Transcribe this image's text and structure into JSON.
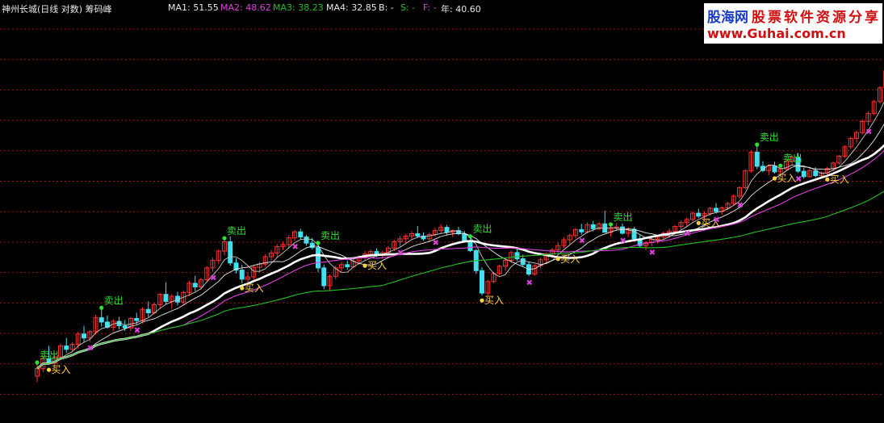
{
  "header": {
    "title": "神州长城(日线 对数) 筹码峰",
    "ma1": "MA1: 51.55",
    "ma2": "MA2: 48.62",
    "ma3": "MA3: 38.23",
    "ma4": "MA4: 32.85",
    "b": "B: -",
    "s": "S: -",
    "f": "F: -",
    "year": "年: 40.60"
  },
  "watermark": {
    "site": "股海网",
    "subtitle": "股票软件资源分享",
    "url": "www.Guhai.com.cn"
  },
  "colors": {
    "background": "#000000",
    "up_candle": "#ff3030",
    "down_candle": "#40e0f0",
    "ma1": "#ffffff",
    "ma2": "#e040e0",
    "ma3": "#20c020",
    "ma4": "#ffffff",
    "sell_signal": "#30e030",
    "buy_signal": "#ffd040",
    "gridline": "#a01818"
  },
  "chart_data": {
    "type": "candlestick",
    "title": "神州长城(日线 对数) 筹码峰",
    "scale": "log",
    "grid": true,
    "ohlc": [
      [
        20.2,
        21.5,
        19.6,
        21.0
      ],
      [
        21.0,
        22.4,
        20.6,
        22.1
      ],
      [
        22.1,
        23.6,
        21.4,
        21.6
      ],
      [
        21.6,
        22.5,
        20.9,
        22.3
      ],
      [
        22.3,
        23.9,
        22.0,
        23.6
      ],
      [
        23.6,
        24.6,
        22.8,
        23.2
      ],
      [
        23.2,
        24.1,
        22.9,
        23.8
      ],
      [
        23.8,
        25.4,
        23.3,
        25.1
      ],
      [
        25.1,
        26.2,
        24.0,
        24.6
      ],
      [
        24.6,
        25.6,
        24.1,
        25.4
      ],
      [
        25.4,
        27.7,
        25.0,
        27.3
      ],
      [
        27.3,
        28.5,
        26.1,
        26.7
      ],
      [
        26.7,
        27.6,
        25.8,
        26.0
      ],
      [
        26.0,
        27.1,
        25.5,
        26.8
      ],
      [
        26.8,
        27.4,
        25.7,
        26.2
      ],
      [
        26.2,
        27.0,
        25.5,
        25.9
      ],
      [
        25.9,
        27.4,
        25.5,
        27.2
      ],
      [
        27.2,
        28.0,
        26.4,
        26.9
      ],
      [
        26.9,
        28.8,
        26.5,
        28.5
      ],
      [
        28.5,
        29.7,
        27.4,
        28.0
      ],
      [
        28.0,
        29.5,
        27.8,
        29.2
      ],
      [
        29.2,
        31.0,
        28.7,
        30.8
      ],
      [
        30.8,
        32.8,
        29.2,
        29.7
      ],
      [
        29.7,
        30.8,
        28.6,
        30.5
      ],
      [
        30.5,
        31.2,
        29.1,
        29.6
      ],
      [
        29.6,
        31.4,
        29.2,
        31.1
      ],
      [
        31.1,
        33.0,
        30.5,
        32.6
      ],
      [
        32.6,
        33.9,
        31.3,
        32.0
      ],
      [
        32.0,
        33.5,
        31.6,
        33.2
      ],
      [
        33.2,
        35.6,
        32.9,
        35.3
      ],
      [
        35.3,
        37.2,
        34.6,
        36.7
      ],
      [
        36.7,
        38.8,
        36.0,
        38.5
      ],
      [
        38.5,
        40.8,
        37.6,
        40.4
      ],
      [
        40.4,
        41.5,
        35.7,
        36.2
      ],
      [
        36.2,
        37.1,
        34.3,
        34.9
      ],
      [
        34.9,
        35.9,
        32.6,
        33.3
      ],
      [
        33.3,
        34.5,
        32.1,
        33.7
      ],
      [
        33.7,
        35.7,
        33.2,
        35.4
      ],
      [
        35.4,
        36.4,
        34.5,
        36.0
      ],
      [
        36.0,
        37.9,
        35.5,
        37.4
      ],
      [
        37.4,
        38.7,
        36.6,
        38.1
      ],
      [
        38.1,
        39.9,
        37.2,
        39.4
      ],
      [
        39.4,
        40.5,
        38.7,
        39.8
      ],
      [
        39.8,
        41.8,
        39.0,
        41.2
      ],
      [
        41.2,
        42.9,
        40.6,
        42.5
      ],
      [
        42.5,
        43.2,
        40.8,
        41.4
      ],
      [
        41.4,
        41.9,
        39.6,
        40.1
      ],
      [
        40.1,
        41.2,
        38.8,
        39.2
      ],
      [
        39.2,
        39.8,
        34.5,
        35.3
      ],
      [
        35.3,
        35.9,
        31.6,
        32.2
      ],
      [
        32.2,
        34.1,
        31.3,
        33.8
      ],
      [
        33.8,
        35.7,
        33.3,
        35.3
      ],
      [
        35.3,
        36.4,
        34.6,
        35.9
      ],
      [
        35.9,
        36.7,
        35.0,
        35.5
      ],
      [
        35.5,
        36.9,
        35.3,
        36.6
      ],
      [
        36.6,
        37.7,
        35.9,
        37.3
      ],
      [
        37.3,
        38.5,
        36.6,
        37.9
      ],
      [
        37.9,
        38.8,
        37.1,
        38.4
      ],
      [
        38.4,
        39.0,
        37.3,
        37.6
      ],
      [
        37.6,
        38.6,
        37.0,
        38.2
      ],
      [
        38.2,
        39.5,
        37.9,
        39.1
      ],
      [
        39.1,
        40.8,
        38.5,
        40.4
      ],
      [
        40.4,
        41.6,
        39.4,
        41.0
      ],
      [
        41.0,
        42.1,
        40.1,
        41.6
      ],
      [
        41.6,
        42.6,
        40.9,
        42.1
      ],
      [
        42.1,
        43.8,
        41.2,
        41.6
      ],
      [
        41.6,
        42.4,
        40.6,
        41.0
      ],
      [
        41.0,
        42.3,
        40.3,
        41.9
      ],
      [
        41.9,
        43.4,
        41.5,
        42.8
      ],
      [
        42.8,
        44.2,
        42.0,
        43.5
      ],
      [
        43.5,
        44.0,
        41.9,
        42.4
      ],
      [
        42.4,
        43.1,
        41.4,
        42.8
      ],
      [
        42.8,
        43.6,
        41.8,
        42.1
      ],
      [
        42.1,
        42.7,
        40.2,
        40.6
      ],
      [
        40.6,
        41.2,
        38.3,
        38.6
      ],
      [
        38.6,
        38.9,
        34.2,
        34.8
      ],
      [
        34.8,
        35.4,
        30.6,
        31.0
      ],
      [
        31.0,
        33.2,
        30.5,
        32.9
      ],
      [
        32.9,
        34.6,
        32.6,
        34.3
      ],
      [
        34.3,
        35.9,
        33.9,
        35.6
      ],
      [
        35.6,
        37.2,
        34.8,
        36.7
      ],
      [
        36.7,
        38.6,
        36.2,
        38.2
      ],
      [
        38.2,
        38.9,
        36.6,
        37.0
      ],
      [
        37.0,
        37.8,
        35.5,
        35.9
      ],
      [
        35.9,
        36.4,
        33.8,
        34.2
      ],
      [
        34.2,
        36.0,
        33.9,
        35.7
      ],
      [
        35.7,
        37.2,
        35.2,
        36.8
      ],
      [
        36.8,
        38.2,
        36.0,
        37.9
      ],
      [
        37.9,
        39.1,
        37.2,
        38.7
      ],
      [
        38.7,
        40.2,
        37.9,
        39.6
      ],
      [
        39.6,
        41.3,
        39.1,
        40.8
      ],
      [
        40.8,
        42.1,
        39.9,
        41.7
      ],
      [
        41.7,
        43.4,
        41.1,
        43.0
      ],
      [
        43.0,
        44.3,
        41.9,
        42.5
      ],
      [
        42.5,
        44.6,
        42.2,
        44.1
      ],
      [
        44.1,
        45.0,
        42.6,
        43.2
      ],
      [
        43.2,
        44.7,
        42.9,
        44.3
      ],
      [
        44.3,
        47.4,
        43.9,
        42.4
      ],
      [
        42.4,
        43.8,
        41.5,
        43.3
      ],
      [
        43.3,
        44.5,
        42.7,
        43.6
      ],
      [
        43.6,
        44.4,
        41.9,
        42.2
      ],
      [
        42.2,
        43.6,
        41.4,
        43.1
      ],
      [
        43.1,
        43.6,
        40.6,
        41.0
      ],
      [
        41.0,
        41.8,
        39.2,
        39.6
      ],
      [
        39.6,
        40.5,
        38.7,
        40.2
      ],
      [
        40.2,
        41.3,
        39.5,
        40.9
      ],
      [
        40.9,
        41.8,
        40.0,
        41.4
      ],
      [
        41.4,
        42.6,
        40.8,
        42.2
      ],
      [
        42.2,
        43.2,
        41.2,
        42.6
      ],
      [
        42.6,
        44.0,
        41.9,
        43.7
      ],
      [
        43.7,
        45.1,
        42.9,
        44.6
      ],
      [
        44.6,
        45.8,
        43.5,
        45.3
      ],
      [
        45.3,
        47.2,
        44.8,
        46.8
      ],
      [
        46.8,
        47.9,
        45.6,
        46.1
      ],
      [
        46.1,
        47.3,
        44.9,
        46.7
      ],
      [
        46.7,
        48.4,
        46.1,
        48.0
      ],
      [
        48.0,
        49.3,
        46.7,
        47.2
      ],
      [
        47.2,
        48.5,
        46.4,
        48.1
      ],
      [
        48.1,
        49.6,
        47.6,
        49.2
      ],
      [
        49.2,
        51.6,
        48.7,
        51.1
      ],
      [
        51.1,
        53.8,
        50.4,
        53.4
      ],
      [
        53.4,
        58.7,
        52.9,
        58.2
      ],
      [
        58.2,
        64.7,
        57.6,
        64.1
      ],
      [
        64.1,
        66.1,
        58.8,
        59.6
      ],
      [
        59.6,
        61.2,
        57.8,
        58.3
      ],
      [
        58.3,
        60.2,
        56.9,
        59.7
      ],
      [
        59.7,
        61.0,
        57.4,
        57.9
      ],
      [
        57.9,
        59.3,
        56.6,
        58.8
      ],
      [
        58.8,
        61.7,
        58.2,
        61.2
      ],
      [
        61.2,
        63.1,
        60.1,
        62.4
      ],
      [
        62.4,
        63.8,
        57.6,
        58.1
      ],
      [
        58.1,
        59.2,
        55.9,
        56.5
      ],
      [
        56.5,
        58.8,
        56.1,
        58.2
      ],
      [
        58.2,
        59.3,
        56.3,
        56.8
      ],
      [
        56.8,
        58.1,
        56.0,
        57.6
      ],
      [
        57.6,
        59.4,
        57.1,
        58.9
      ],
      [
        58.9,
        61.0,
        58.2,
        60.6
      ],
      [
        60.6,
        63.2,
        60.1,
        62.8
      ],
      [
        62.8,
        66.4,
        62.2,
        65.9
      ],
      [
        65.9,
        69.4,
        65.2,
        68.8
      ],
      [
        68.8,
        71.7,
        67.3,
        70.9
      ],
      [
        70.9,
        75.8,
        70.1,
        75.1
      ],
      [
        75.1,
        79.0,
        73.6,
        78.3
      ],
      [
        78.3,
        83.9,
        77.5,
        83.2
      ],
      [
        83.2,
        90.1,
        82.3,
        89.3
      ],
      [
        89.3,
        98.4,
        88.3,
        97.5
      ],
      [
        97.5,
        103.4,
        95.1,
        101.5
      ],
      [
        101.5,
        106.8,
        99.6,
        105.8
      ],
      [
        105.8,
        112.1,
        103.5,
        110.9
      ],
      [
        110.9,
        117.6,
        108.2,
        116.4
      ],
      [
        116.4,
        119.5,
        109.6,
        111.2
      ],
      [
        111.2,
        115.4,
        108.9,
        113.8
      ],
      [
        113.8,
        117.9,
        111.4,
        115.6
      ],
      [
        115.6,
        119.3,
        110.6,
        112.1
      ],
      [
        112.1,
        115.0,
        107.3,
        108.7
      ],
      [
        108.7,
        110.6,
        101.6,
        103.2
      ],
      [
        103.2,
        105.7,
        97.6,
        99.1
      ],
      [
        99.1,
        100.9,
        91.8,
        93.2
      ],
      [
        93.2,
        94.7,
        85.0,
        86.2
      ],
      [
        86.2,
        87.5,
        76.4,
        77.6
      ],
      [
        77.6,
        78.9,
        65.3,
        66.4
      ]
    ],
    "ma1_last": 51.55,
    "ma2_last": 48.62,
    "ma3_last": 38.23,
    "ma4_last": 32.85,
    "year_value": 40.6,
    "sell_signals": [
      {
        "index": 0,
        "label": "卖出"
      },
      {
        "index": 11,
        "label": "卖出"
      },
      {
        "index": 32,
        "label": "卖出"
      },
      {
        "index": 48,
        "label": "卖出"
      },
      {
        "index": 74,
        "label": "卖出"
      },
      {
        "index": 98,
        "label": "卖出"
      },
      {
        "index": 123,
        "label": "卖出"
      },
      {
        "index": 127,
        "label": "卖出"
      }
    ],
    "buy_signals": [
      {
        "index": 2,
        "label": "买入"
      },
      {
        "index": 35,
        "label": "买入"
      },
      {
        "index": 56,
        "label": "买入"
      },
      {
        "index": 76,
        "label": "买入"
      },
      {
        "index": 89,
        "label": "买入"
      },
      {
        "index": 113,
        "label": "买入"
      },
      {
        "index": 126,
        "label": "买入"
      },
      {
        "index": 135,
        "label": "买入"
      }
    ],
    "purple_markers": [
      9,
      17,
      30,
      44,
      62,
      68,
      84,
      93,
      100,
      105,
      111,
      116,
      120,
      130,
      142
    ]
  }
}
